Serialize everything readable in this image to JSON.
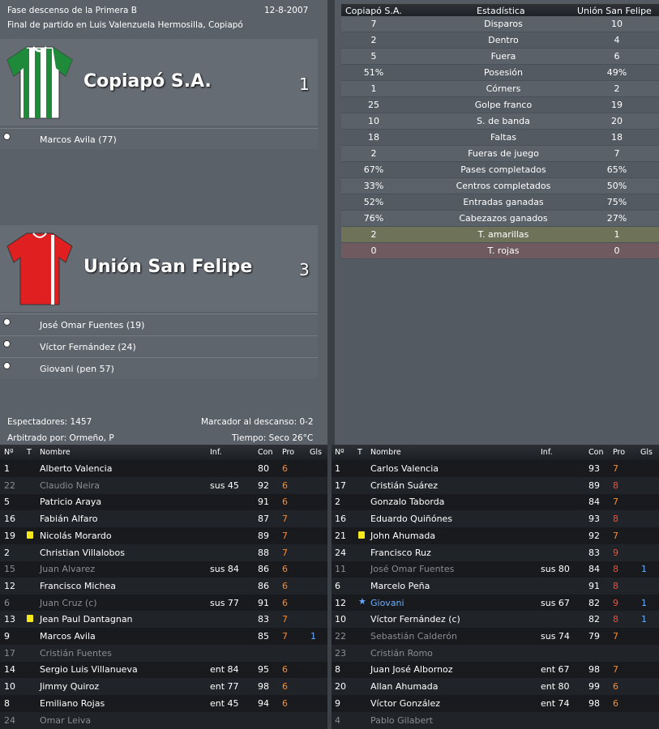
{
  "match": {
    "competition": "Fase descenso de la Primera B",
    "date": "12-8-2007",
    "venue_line": "Final de partido en Luis Valenzuela Hermosilla, Copiapó"
  },
  "home": {
    "name": "Copiapó S.A.",
    "score": "1",
    "color": "#1e8a3a",
    "scorers": [
      "Marcos Avila (77)"
    ]
  },
  "away": {
    "name": "Unión San Felipe",
    "score": "3",
    "color": "#e02020",
    "scorers": [
      "José Omar Fuentes (19)",
      "Víctor Fernández (24)",
      "Giovani (pen 57)"
    ]
  },
  "footer": {
    "attendance": "Espectadores: 1457",
    "halftime": "Marcador al descanso: 0-2",
    "referee": "Arbitrado por: Ormeño, P",
    "weather": "Tiempo: Seco 26°C"
  },
  "stats": {
    "header": {
      "home": "Copiapó S.A.",
      "label": "Estadística",
      "away": "Unión San Felipe"
    },
    "rows": [
      {
        "home": "7",
        "label": "Disparos",
        "away": "10"
      },
      {
        "home": "2",
        "label": "Dentro",
        "away": "4"
      },
      {
        "home": "5",
        "label": "Fuera",
        "away": "6"
      },
      {
        "home": "51%",
        "label": "Posesión",
        "away": "49%"
      },
      {
        "home": "1",
        "label": "Córners",
        "away": "2"
      },
      {
        "home": "25",
        "label": "Golpe franco",
        "away": "19"
      },
      {
        "home": "10",
        "label": "S. de banda",
        "away": "20"
      },
      {
        "home": "18",
        "label": "Faltas",
        "away": "18"
      },
      {
        "home": "2",
        "label": "Fueras de juego",
        "away": "7"
      },
      {
        "home": "67%",
        "label": "Pases completados",
        "away": "65%"
      },
      {
        "home": "33%",
        "label": "Centros completados",
        "away": "50%"
      },
      {
        "home": "52%",
        "label": "Entradas ganadas",
        "away": "75%"
      },
      {
        "home": "76%",
        "label": "Cabezazos ganados",
        "away": "27%"
      },
      {
        "home": "2",
        "label": "T. amarillas",
        "away": "1"
      },
      {
        "home": "0",
        "label": "T. rojas",
        "away": "0"
      }
    ]
  },
  "lineup_headers": {
    "num": "Nº",
    "t": "T",
    "name": "Nombre",
    "inf": "Inf.",
    "con": "Con",
    "pro": "Pro",
    "gls": "Gls"
  },
  "home_lineup": [
    {
      "num": "1",
      "name": "Alberto Valencia",
      "inf": "",
      "con": "80",
      "pro": "6",
      "gls": "",
      "sub": false,
      "yc": false
    },
    {
      "num": "22",
      "name": "Claudio Neira",
      "inf": "sus 45",
      "con": "92",
      "pro": "6",
      "gls": "",
      "sub": true,
      "yc": false
    },
    {
      "num": "5",
      "name": "Patricio Araya",
      "inf": "",
      "con": "91",
      "pro": "6",
      "gls": "",
      "sub": false,
      "yc": false
    },
    {
      "num": "16",
      "name": "Fabián Alfaro",
      "inf": "",
      "con": "87",
      "pro": "7",
      "gls": "",
      "sub": false,
      "yc": false
    },
    {
      "num": "19",
      "name": "Nicolás Morardo",
      "inf": "",
      "con": "89",
      "pro": "7",
      "gls": "",
      "sub": false,
      "yc": true
    },
    {
      "num": "2",
      "name": "Christian Villalobos",
      "inf": "",
      "con": "88",
      "pro": "7",
      "gls": "",
      "sub": false,
      "yc": false
    },
    {
      "num": "15",
      "name": "Juan Alvarez",
      "inf": "sus 84",
      "con": "86",
      "pro": "6",
      "gls": "",
      "sub": true,
      "yc": false
    },
    {
      "num": "12",
      "name": "Francisco Michea",
      "inf": "",
      "con": "86",
      "pro": "6",
      "gls": "",
      "sub": false,
      "yc": false
    },
    {
      "num": "6",
      "name": "Juan Cruz (c)",
      "inf": "sus 77",
      "con": "91",
      "pro": "6",
      "gls": "",
      "sub": true,
      "yc": false
    },
    {
      "num": "13",
      "name": "Jean Paul Dantagnan",
      "inf": "",
      "con": "83",
      "pro": "7",
      "gls": "",
      "sub": false,
      "yc": true
    },
    {
      "num": "9",
      "name": "Marcos Avila",
      "inf": "",
      "con": "85",
      "pro": "7",
      "gls": "1",
      "sub": false,
      "yc": false
    },
    {
      "num": "17",
      "name": "Cristián Fuentes",
      "inf": "",
      "con": "",
      "pro": "",
      "gls": "",
      "sub": true,
      "yc": false
    },
    {
      "num": "14",
      "name": "Sergio Luis Villanueva",
      "inf": "ent 84",
      "con": "95",
      "pro": "6",
      "gls": "",
      "sub": false,
      "yc": false
    },
    {
      "num": "10",
      "name": "Jimmy Quiroz",
      "inf": "ent 77",
      "con": "98",
      "pro": "6",
      "gls": "",
      "sub": false,
      "yc": false
    },
    {
      "num": "8",
      "name": "Emiliano Rojas",
      "inf": "ent 45",
      "con": "94",
      "pro": "6",
      "gls": "",
      "sub": false,
      "yc": false
    },
    {
      "num": "24",
      "name": "Omar Leiva",
      "inf": "",
      "con": "",
      "pro": "",
      "gls": "",
      "sub": true,
      "yc": false
    }
  ],
  "away_lineup": [
    {
      "num": "1",
      "name": "Carlos Valencia",
      "inf": "",
      "con": "93",
      "pro": "7",
      "gls": "",
      "sub": false,
      "star": false,
      "proColor": "orange"
    },
    {
      "num": "17",
      "name": "Cristián Suárez",
      "inf": "",
      "con": "89",
      "pro": "8",
      "gls": "",
      "sub": false,
      "star": false,
      "proColor": "red"
    },
    {
      "num": "2",
      "name": "Gonzalo Taborda",
      "inf": "",
      "con": "84",
      "pro": "7",
      "gls": "",
      "sub": false,
      "star": false,
      "proColor": "orange"
    },
    {
      "num": "16",
      "name": "Eduardo Quiñónes",
      "inf": "",
      "con": "93",
      "pro": "8",
      "gls": "",
      "sub": false,
      "star": false,
      "proColor": "red"
    },
    {
      "num": "21",
      "name": "John Ahumada",
      "inf": "",
      "con": "92",
      "pro": "7",
      "gls": "",
      "sub": false,
      "star": false,
      "yc": true,
      "proColor": "orange"
    },
    {
      "num": "24",
      "name": "Francisco Ruz",
      "inf": "",
      "con": "83",
      "pro": "9",
      "gls": "",
      "sub": false,
      "star": false,
      "proColor": "red"
    },
    {
      "num": "11",
      "name": "José Omar Fuentes",
      "inf": "sus 80",
      "con": "84",
      "pro": "8",
      "gls": "1",
      "sub": true,
      "star": false,
      "proColor": "red"
    },
    {
      "num": "6",
      "name": "Marcelo Peña",
      "inf": "",
      "con": "91",
      "pro": "8",
      "gls": "",
      "sub": false,
      "star": false,
      "proColor": "red"
    },
    {
      "num": "12",
      "name": "Giovani",
      "inf": "sus 67",
      "con": "82",
      "pro": "9",
      "gls": "1",
      "sub": false,
      "star": true,
      "proColor": "red"
    },
    {
      "num": "10",
      "name": "Víctor Fernández (c)",
      "inf": "",
      "con": "82",
      "pro": "8",
      "gls": "1",
      "sub": false,
      "star": false,
      "proColor": "red"
    },
    {
      "num": "22",
      "name": "Sebastián Calderón",
      "inf": "sus 74",
      "con": "79",
      "pro": "7",
      "gls": "",
      "sub": true,
      "star": false,
      "proColor": "orange"
    },
    {
      "num": "23",
      "name": "Cristián Romo",
      "inf": "",
      "con": "",
      "pro": "",
      "gls": "",
      "sub": true,
      "star": false,
      "proColor": "orange"
    },
    {
      "num": "8",
      "name": "Juan José Albornoz",
      "inf": "ent 67",
      "con": "98",
      "pro": "7",
      "gls": "",
      "sub": false,
      "star": false,
      "proColor": "orange"
    },
    {
      "num": "20",
      "name": "Allan Ahumada",
      "inf": "ent 80",
      "con": "99",
      "pro": "6",
      "gls": "",
      "sub": false,
      "star": false,
      "proColor": "orange"
    },
    {
      "num": "9",
      "name": "Víctor González",
      "inf": "ent 74",
      "con": "98",
      "pro": "6",
      "gls": "",
      "sub": false,
      "star": false,
      "proColor": "orange"
    },
    {
      "num": "4",
      "name": "Pablo Gilabert",
      "inf": "",
      "con": "",
      "pro": "",
      "gls": "",
      "sub": true,
      "star": false,
      "proColor": "orange"
    }
  ]
}
